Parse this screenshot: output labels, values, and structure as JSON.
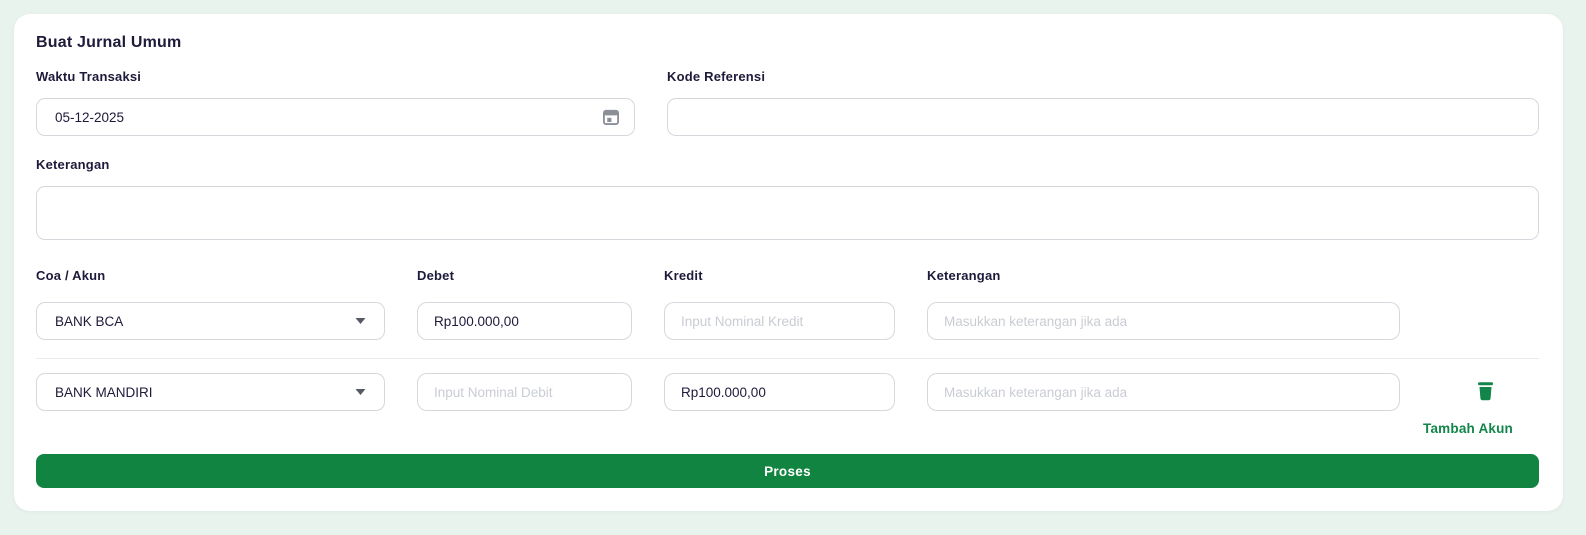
{
  "card": {
    "title": "Buat Jurnal Umum"
  },
  "transaction": {
    "waktu_label": "Waktu Transaksi",
    "waktu_value": "05-12-2025",
    "kode_label": "Kode Referensi",
    "kode_value": "",
    "keterangan_label": "Keterangan",
    "keterangan_value": ""
  },
  "entries": {
    "headers": {
      "coa": "Coa / Akun",
      "debet": "Debet",
      "kredit": "Kredit",
      "keterangan": "Keterangan"
    },
    "placeholders": {
      "debet": "Input Nominal Debit",
      "kredit": "Input Nominal Kredit",
      "keterangan": "Masukkan keterangan jika ada"
    },
    "rows": [
      {
        "coa": "BANK BCA",
        "debet": "Rp100.000,00",
        "kredit": "",
        "keterangan": ""
      },
      {
        "coa": "BANK MANDIRI",
        "debet": "",
        "kredit": "Rp100.000,00",
        "keterangan": ""
      }
    ]
  },
  "actions": {
    "tambah_akun_label": "Tambah Akun",
    "proses_label": "Proses"
  },
  "colors": {
    "page_background": "#e9f3ee",
    "card_background": "#ffffff",
    "accent_green": "#118441",
    "link_green": "#12854a",
    "ink": "#1d1a3a",
    "input_border": "#d5d8dd",
    "placeholder": "#c9cdd3"
  }
}
